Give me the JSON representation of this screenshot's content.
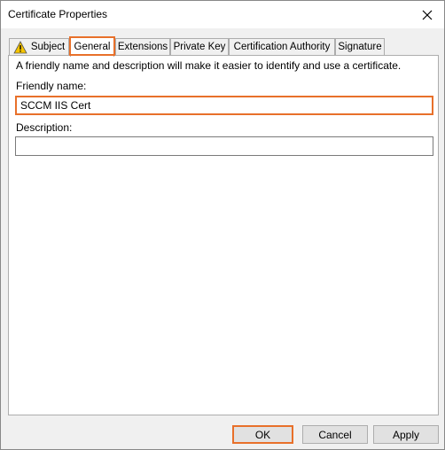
{
  "window": {
    "title": "Certificate Properties"
  },
  "tabs": [
    {
      "label": "Subject",
      "icon": "warning-icon"
    },
    {
      "label": "General",
      "active": true
    },
    {
      "label": "Extensions"
    },
    {
      "label": "Private Key"
    },
    {
      "label": "Certification Authority"
    },
    {
      "label": "Signature"
    }
  ],
  "general": {
    "intro": "A friendly name and description will make it easier to identify and use a certificate.",
    "friendly_name_label": "Friendly name:",
    "friendly_name_value": "SCCM IIS Cert",
    "description_label": "Description:",
    "description_value": ""
  },
  "buttons": {
    "ok": "OK",
    "cancel": "Cancel",
    "apply": "Apply"
  },
  "colors": {
    "highlight": "#e8702a",
    "warning": "#f5c400"
  }
}
